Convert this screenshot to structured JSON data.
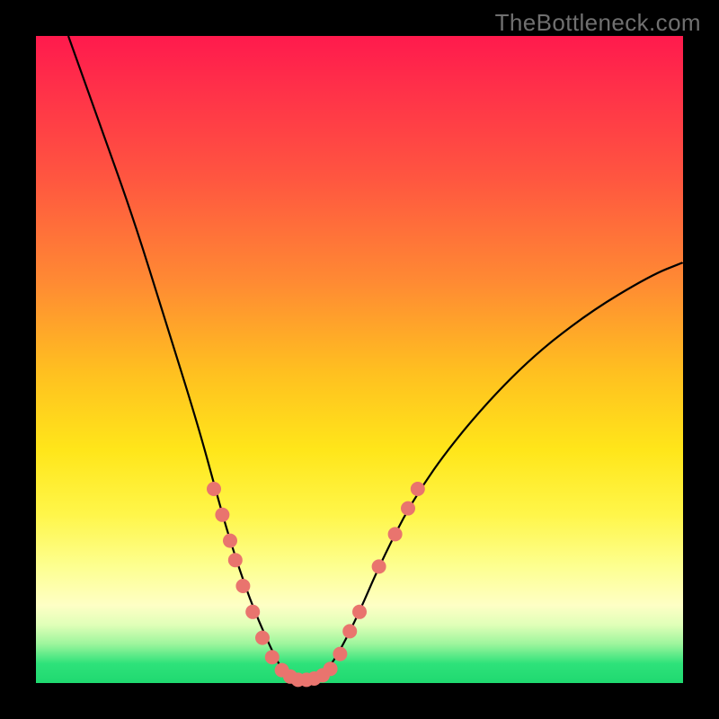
{
  "watermark": "TheBottleneck.com",
  "colors": {
    "gradient_top": "#ff1a4d",
    "gradient_mid": "#ffe61a",
    "gradient_bottom": "#1fd970",
    "curve": "#000000",
    "dots": "#e9746e",
    "frame": "#000000",
    "watermark_text": "#707070"
  },
  "chart_data": {
    "type": "line",
    "title": "",
    "xlabel": "",
    "ylabel": "",
    "xlim": [
      0,
      100
    ],
    "ylim": [
      0,
      100
    ],
    "note": "y-axis is inverted visually (0 at bottom, 100 at top). Curve is a smooth V-shaped bottleneck; minimum ≈0 at x≈41. Values below estimated from pixel positions.",
    "series": [
      {
        "name": "bottleneck-curve",
        "x": [
          5,
          10,
          15,
          20,
          25,
          28,
          30,
          33,
          36,
          38,
          40,
          42,
          45,
          47,
          50,
          53,
          58,
          65,
          75,
          85,
          95,
          100
        ],
        "y": [
          100,
          86,
          72,
          56,
          40,
          29,
          22,
          13,
          6,
          2,
          0.5,
          0.5,
          2,
          5,
          11,
          18,
          28,
          38,
          49,
          57,
          63,
          65
        ]
      }
    ],
    "scatter_points": {
      "name": "sample-dots",
      "points": [
        {
          "x": 27.5,
          "y": 30
        },
        {
          "x": 28.8,
          "y": 26
        },
        {
          "x": 30.0,
          "y": 22
        },
        {
          "x": 30.8,
          "y": 19
        },
        {
          "x": 32.0,
          "y": 15
        },
        {
          "x": 33.5,
          "y": 11
        },
        {
          "x": 35.0,
          "y": 7
        },
        {
          "x": 36.5,
          "y": 4
        },
        {
          "x": 38.0,
          "y": 2
        },
        {
          "x": 39.3,
          "y": 1
        },
        {
          "x": 40.5,
          "y": 0.5
        },
        {
          "x": 41.8,
          "y": 0.5
        },
        {
          "x": 43.0,
          "y": 0.7
        },
        {
          "x": 44.3,
          "y": 1.2
        },
        {
          "x": 45.5,
          "y": 2.2
        },
        {
          "x": 47.0,
          "y": 4.5
        },
        {
          "x": 48.5,
          "y": 8
        },
        {
          "x": 50.0,
          "y": 11
        },
        {
          "x": 53.0,
          "y": 18
        },
        {
          "x": 55.5,
          "y": 23
        },
        {
          "x": 57.5,
          "y": 27
        },
        {
          "x": 59.0,
          "y": 30
        }
      ]
    }
  }
}
